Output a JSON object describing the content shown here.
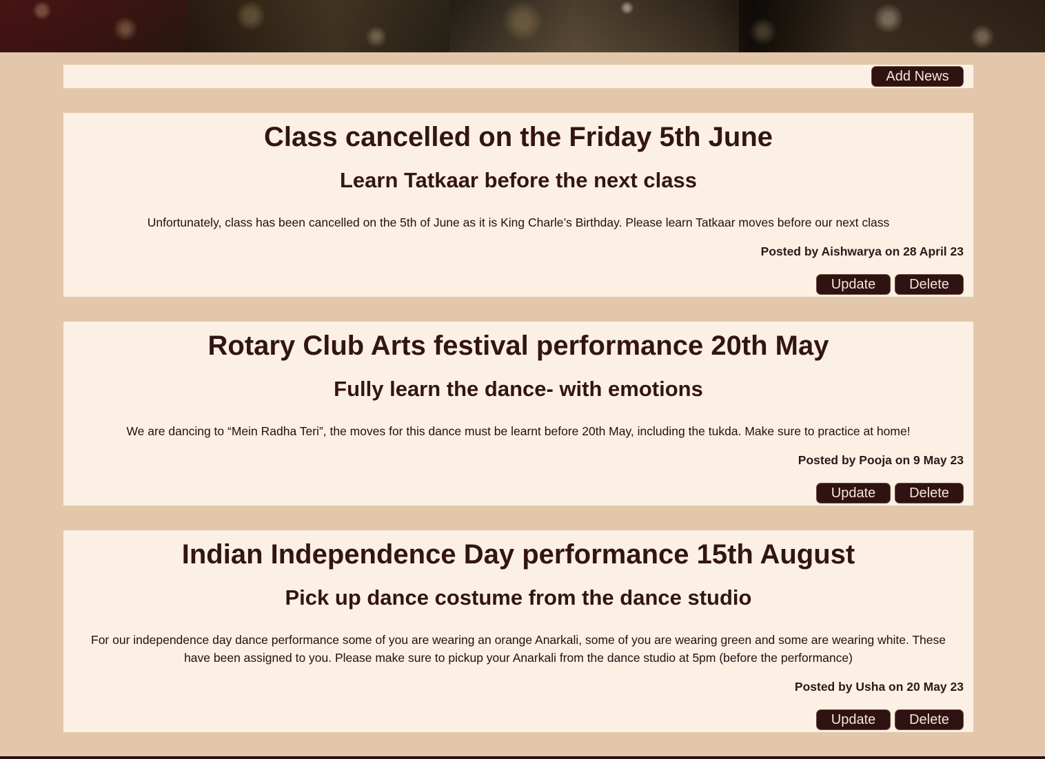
{
  "toolbar": {
    "add_news_label": "Add News"
  },
  "posts": [
    {
      "title": "Class cancelled on the Friday 5th June",
      "subtitle": "Learn Tatkaar before the next class",
      "body": "Unfortunately, class has been cancelled on the 5th of June as it is King Charle’s Birthday. Please learn Tatkaar moves before our next class",
      "meta": "Posted by Aishwarya on 28 April 23",
      "update_label": "Update",
      "delete_label": "Delete"
    },
    {
      "title": "Rotary Club Arts festival performance 20th May",
      "subtitle": "Fully learn the dance- with emotions",
      "body": "We are dancing to “Mein Radha Teri”, the moves for this dance must be learnt before 20th May, including the tukda. Make sure to practice at home!",
      "meta": "Posted by Pooja on 9 May 23",
      "update_label": "Update",
      "delete_label": "Delete"
    },
    {
      "title": "Indian Independence Day performance 15th August",
      "subtitle": "Pick up dance costume from the dance studio",
      "body": "For our independence day dance performance some of you are wearing an orange Anarkali, some of you are wearing green and some are wearing white. These have been assigned to you. Please make sure to pickup your Anarkali from the dance studio at 5pm (before the performance)",
      "meta": "Posted by Usha on 20 May 23",
      "update_label": "Update",
      "delete_label": "Delete"
    }
  ]
}
